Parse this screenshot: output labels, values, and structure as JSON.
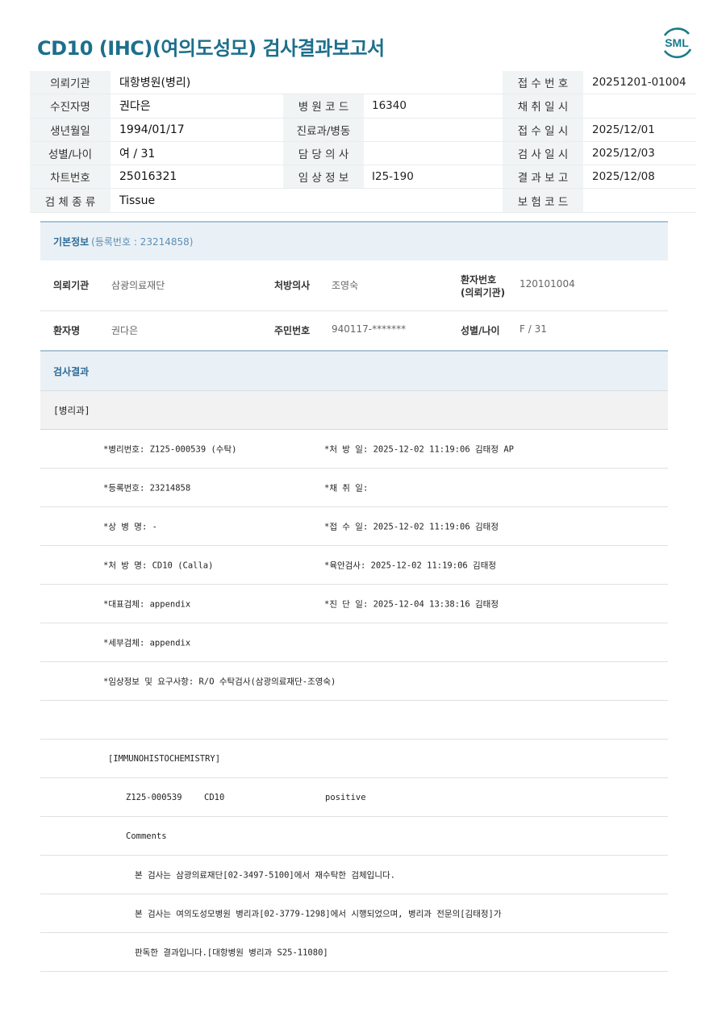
{
  "title": "CD10 (IHC)(여의도성모) 검사결과보고서",
  "logo_text": "SML",
  "header_rows": [
    {
      "l1": "의뢰기관",
      "v1": "대항병원(병리)",
      "l2": "",
      "v2": "",
      "l3": "접 수 번 호",
      "v3": "20251201-01004"
    },
    {
      "l1": "수진자명",
      "v1": "권다은",
      "l2": "병 원 코 드",
      "v2": "16340",
      "l3": "채 취 일 시",
      "v3": ""
    },
    {
      "l1": "생년월일",
      "v1": "1994/01/17",
      "l2": "진료과/병동",
      "v2": "",
      "l3": "접 수 일 시",
      "v3": "2025/12/01"
    },
    {
      "l1": "성별/나이",
      "v1": "여 / 31",
      "l2": "담 당 의 사",
      "v2": "",
      "l3": "검 사 일 시",
      "v3": "2025/12/03"
    },
    {
      "l1": "차트번호",
      "v1": "25016321",
      "l2": "임 상 정 보",
      "v2": "I25-190",
      "l3": "결 과 보 고",
      "v3": "2025/12/08"
    },
    {
      "l1": "검 체 종 류",
      "v1": "Tissue",
      "l2": "",
      "v2": "",
      "l3": "보 험 코 드",
      "v3": ""
    }
  ],
  "basic_info": {
    "title": "기본정보",
    "reg_no": "(등록번호 : 23214858)",
    "row1": {
      "k1": "의뢰기관",
      "v1": "삼광의료재단",
      "k2": "처방의사",
      "v2": "조영숙",
      "k3a": "환자번호",
      "k3b": "(의뢰기관)",
      "v3": "120101004"
    },
    "row2": {
      "k1": "환자명",
      "v1": "권다은",
      "k2": "주민번호",
      "v2": "940117-*******",
      "k3": "성별/나이",
      "v3": "F / 31"
    }
  },
  "result": {
    "title": "검사결과",
    "dept": "[병리과]",
    "r1a": "*병리번호: Z125-000539 (수탁)",
    "r1b": "*처 방 일: 2025-12-02 11:19:06  김태정 AP",
    "r2a": "*등록번호: 23214858",
    "r2b": "*채 취 일:",
    "r3a": "*상 병 명: -",
    "r3b": "*접 수 일: 2025-12-02 11:19:06  김태정",
    "r4a": "*처 방 명: CD10 (Calla)",
    "r4b": "*육안검사: 2025-12-02 11:19:06  김태정",
    "r5a": "*대표검체: appendix",
    "r5b": "*진 단 일: 2025-12-04 13:38:16  김태정",
    "r6a": "*세부검체: appendix",
    "r7a": "*임상정보 및 요구사항: R/O 수탁검사(삼광의료재단-조영숙)",
    "ihc_header": "[IMMUNOHISTOCHEMISTRY]",
    "ihc_no": "Z125-000539",
    "ihc_marker": "CD10",
    "ihc_result": "positive",
    "comments": "Comments",
    "c1": "본 검사는 삼광의료재단[02-3497-5100]에서 재수탁한 검체입니다.",
    "c2": "본 검사는 여의도성모병원 병리과[02-3779-1298]에서 시행되었으며, 병리과 전문의[김태정]가",
    "c3": "판독한 결과입니다.[대항병원 병리과 S25-11080]"
  },
  "colors": {
    "accent": "#1d6f8c",
    "logo": "#1a7a8a",
    "section_bg": "#eaf1f6",
    "label_bg": "#f1f4f5"
  }
}
